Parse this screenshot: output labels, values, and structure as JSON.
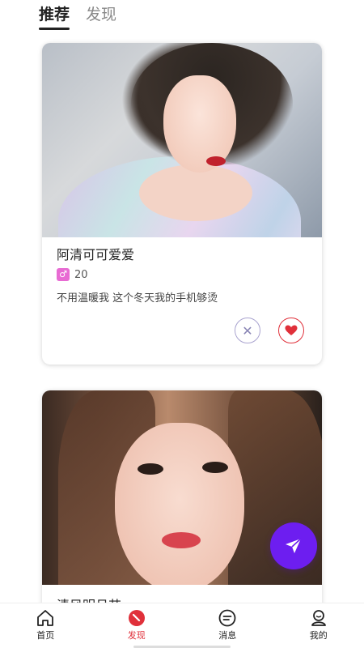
{
  "top_tabs": [
    {
      "label": "推荐",
      "active": true
    },
    {
      "label": "发现",
      "active": false
    }
  ],
  "cards": [
    {
      "name": "阿清可可爱爱",
      "gender_icon": "female-symbol-icon",
      "age": "20",
      "bio": "不用温暖我  这个冬天我的手机够烫",
      "dislike_icon": "close-icon",
      "like_icon": "heart-icon"
    },
    {
      "name": "清风明月芯"
    }
  ],
  "fab": {
    "icon": "send-icon"
  },
  "bottom_nav": [
    {
      "label": "首页",
      "icon": "home-icon",
      "active": false
    },
    {
      "label": "发现",
      "icon": "compass-icon",
      "active": true
    },
    {
      "label": "消息",
      "icon": "message-icon",
      "active": false
    },
    {
      "label": "我的",
      "icon": "profile-icon",
      "active": false
    }
  ],
  "colors": {
    "accent_red": "#e0303a",
    "fab_purple": "#6d1ef0",
    "gender_pink": "#e86bd3"
  }
}
